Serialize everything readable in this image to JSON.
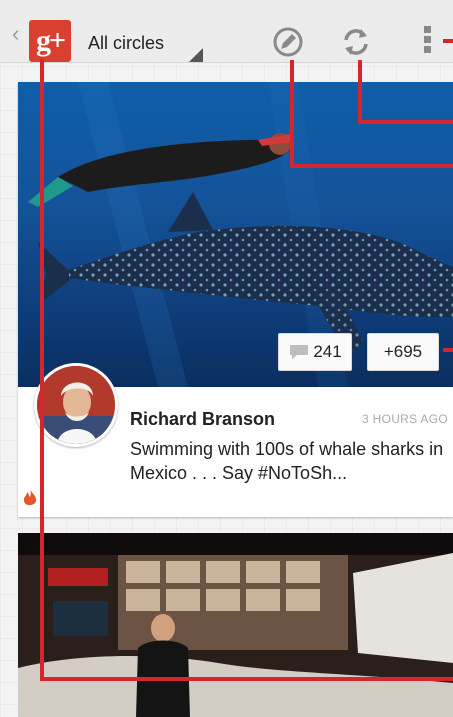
{
  "action_bar": {
    "app_logo": "g+",
    "circles_selector": "All circles",
    "icons": [
      "back-chevron-icon",
      "google-plus-logo-icon",
      "dropdown-triangle-icon",
      "edit-pen-icon",
      "refresh-icon",
      "overflow-menu-icon"
    ]
  },
  "posts": [
    {
      "author": "Richard Branson",
      "time": "3 HOURS AGO",
      "text": "Swimming with 100s of whale sharks in Mexico . . . Say #NoToSh...",
      "comments": "241",
      "plus_ones": "+695"
    }
  ],
  "colors": {
    "brand_red": "#d9402f",
    "callout_red": "#d6252d",
    "actionbar_bg": "#ececec",
    "page_bg": "#f3f3f3"
  }
}
